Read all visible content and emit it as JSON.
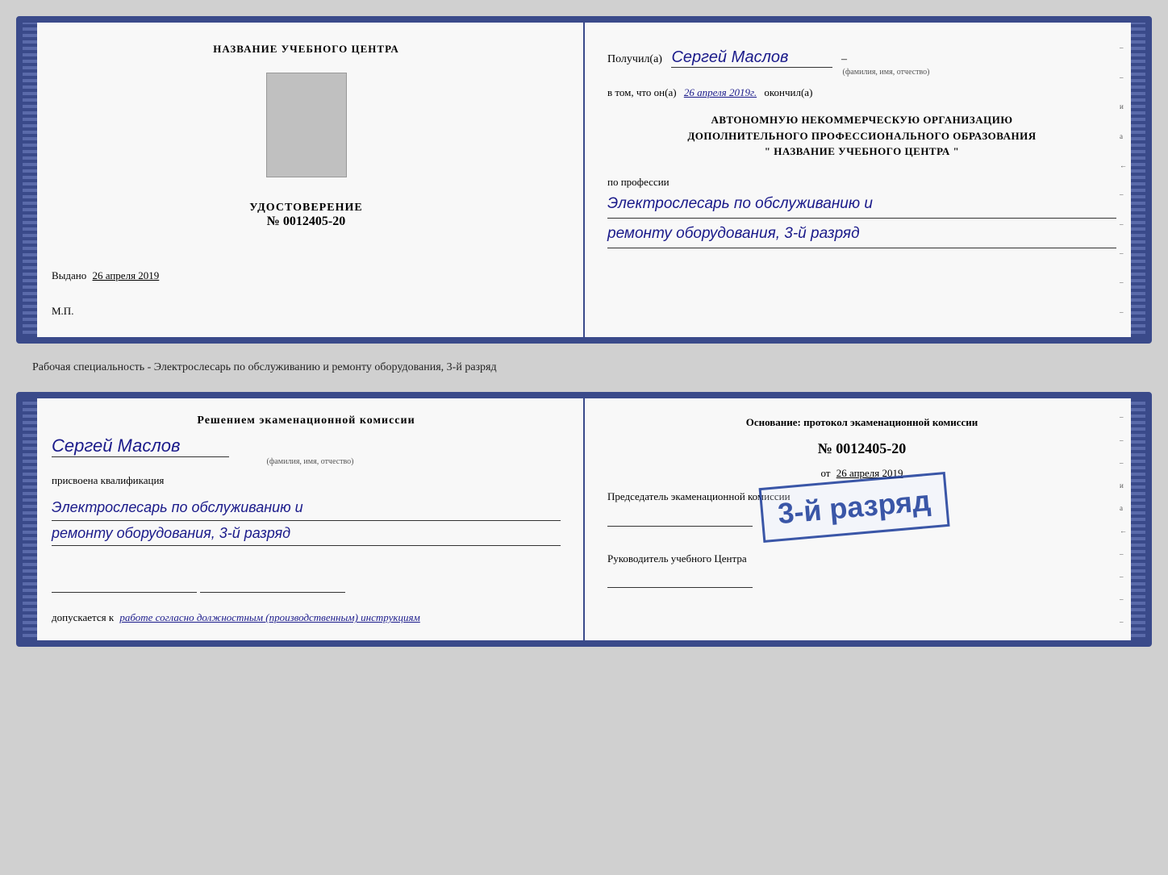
{
  "top_cert": {
    "left": {
      "center_title": "НАЗВАНИЕ УЧЕБНОГО ЦЕНТРА",
      "udost_label": "УДОСТОВЕРЕНИЕ",
      "udost_number": "№ 0012405-20",
      "issued_label": "Выдано",
      "issued_date": "26 апреля 2019",
      "mp_label": "М.П."
    },
    "right": {
      "recipient_prefix": "Получил(а)",
      "recipient_name": "Сергей Маслов",
      "recipient_sublabel": "(фамилия, имя, отчество)",
      "in_tom_prefix": "в том, что он(а)",
      "in_tom_date": "26 апреля 2019г.",
      "in_tom_suffix": "окончил(а)",
      "org_line1": "АВТОНОМНУЮ НЕКОММЕРЧЕСКУЮ ОРГАНИЗАЦИЮ",
      "org_line2": "ДОПОЛНИТЕЛЬНОГО ПРОФЕССИОНАЛЬНОГО ОБРАЗОВАНИЯ",
      "org_line3": "\"  НАЗВАНИЕ УЧЕБНОГО ЦЕНТРА  \"",
      "profession_prefix": "по профессии",
      "profession_text": "Электрослесарь по обслуживанию и",
      "profession_text2": "ремонту оборудования, 3-й разряд"
    }
  },
  "middle": {
    "text": "Рабочая специальность - Электрослесарь по обслуживанию и ремонту оборудования, 3-й разряд"
  },
  "bottom_cert": {
    "left": {
      "decision_title": "Решением экаменационной комиссии",
      "person_name": "Сергей Маслов",
      "person_sublabel": "(фамилия, имя, отчество)",
      "assigned_label": "присвоена квалификация",
      "qualification_text": "Электрослесарь по обслуживанию и",
      "qualification_text2": "ремонту оборудования, 3-й разряд",
      "dopuskaetsya_prefix": "допускается к",
      "dopuskaetsya_text": "работе согласно должностным (производственным) инструкциям"
    },
    "right": {
      "osnov_label": "Основание: протокол экаменационной комиссии",
      "proto_number": "№  0012405-20",
      "proto_date_prefix": "от",
      "proto_date": "26 апреля 2019",
      "chairman_label": "Председатель экаменационной комиссии",
      "rukov_label": "Руководитель учебного Центра"
    },
    "stamp_text": "3-й разряд"
  }
}
